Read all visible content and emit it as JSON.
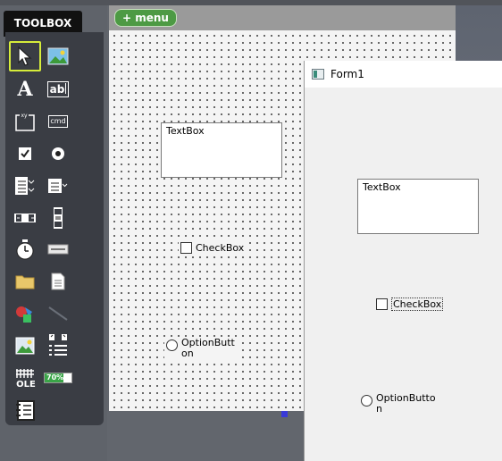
{
  "toolbox": {
    "tab_label": "TOOLBOX",
    "tools": [
      {
        "name": "pointer-icon"
      },
      {
        "name": "picturebox-icon"
      },
      {
        "name": "label-icon"
      },
      {
        "name": "textbox-icon"
      },
      {
        "name": "frame-icon"
      },
      {
        "name": "commandbutton-icon"
      },
      {
        "name": "checkbox-icon"
      },
      {
        "name": "optionbutton-icon"
      },
      {
        "name": "combobox-icon"
      },
      {
        "name": "listbox-icon"
      },
      {
        "name": "hscrollbar-icon"
      },
      {
        "name": "vscrollbar-icon"
      },
      {
        "name": "timer-icon"
      },
      {
        "name": "drivelistbox-icon"
      },
      {
        "name": "dirlistbox-icon"
      },
      {
        "name": "filelistbox-icon"
      },
      {
        "name": "shape-icon"
      },
      {
        "name": "line-icon"
      },
      {
        "name": "image-icon"
      },
      {
        "name": "data-icon"
      },
      {
        "name": "ole-icon"
      },
      {
        "name": "progressbar-icon"
      },
      {
        "name": "listview-icon"
      }
    ],
    "ole_text": "OLE",
    "progress_text": "70%",
    "progress_value": 0.7,
    "cmd_text": "cmd",
    "label_glyph": "A",
    "textbox_glyph": "ab"
  },
  "designer": {
    "menu_label": "+ menu",
    "textbox_text": "TextBox",
    "checkbox_label": "CheckBox",
    "option_label": "OptionButton"
  },
  "form": {
    "title": "Form1",
    "textbox_text": "TextBox",
    "checkbox_label": "CheckBox",
    "option_label": "OptionButton"
  },
  "colors": {
    "selection": "#d6ec3a",
    "menu_green": "#4d9a44",
    "handle_blue": "#3a3ad8"
  }
}
